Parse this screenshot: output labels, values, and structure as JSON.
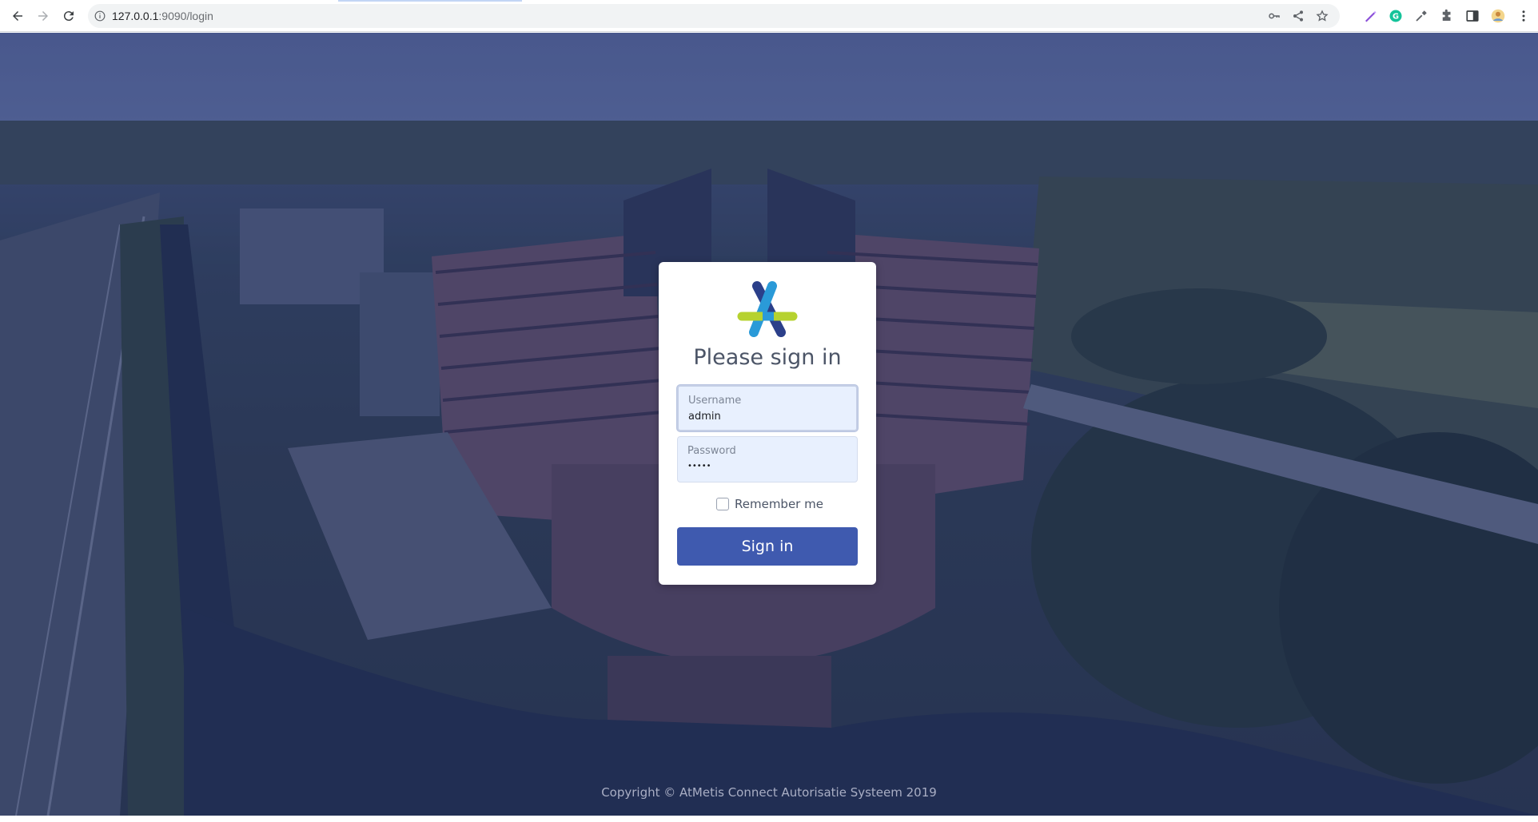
{
  "browser": {
    "url_host": "127.0.0.1",
    "url_rest": ":9090/login"
  },
  "login": {
    "title": "Please sign in",
    "username_label": "Username",
    "username_value": "admin",
    "password_label": "Password",
    "password_value": "•••••",
    "remember_label": "Remember me",
    "signin_label": "Sign in"
  },
  "footer": {
    "copyright": "Copyright © AtMetis Connect Autorisatie Systeem 2019"
  },
  "colors": {
    "primary_button": "#3f5aaf",
    "logo_navy": "#2b3f8a",
    "logo_blue": "#2a9ad8",
    "logo_lime": "#b6d22f"
  }
}
